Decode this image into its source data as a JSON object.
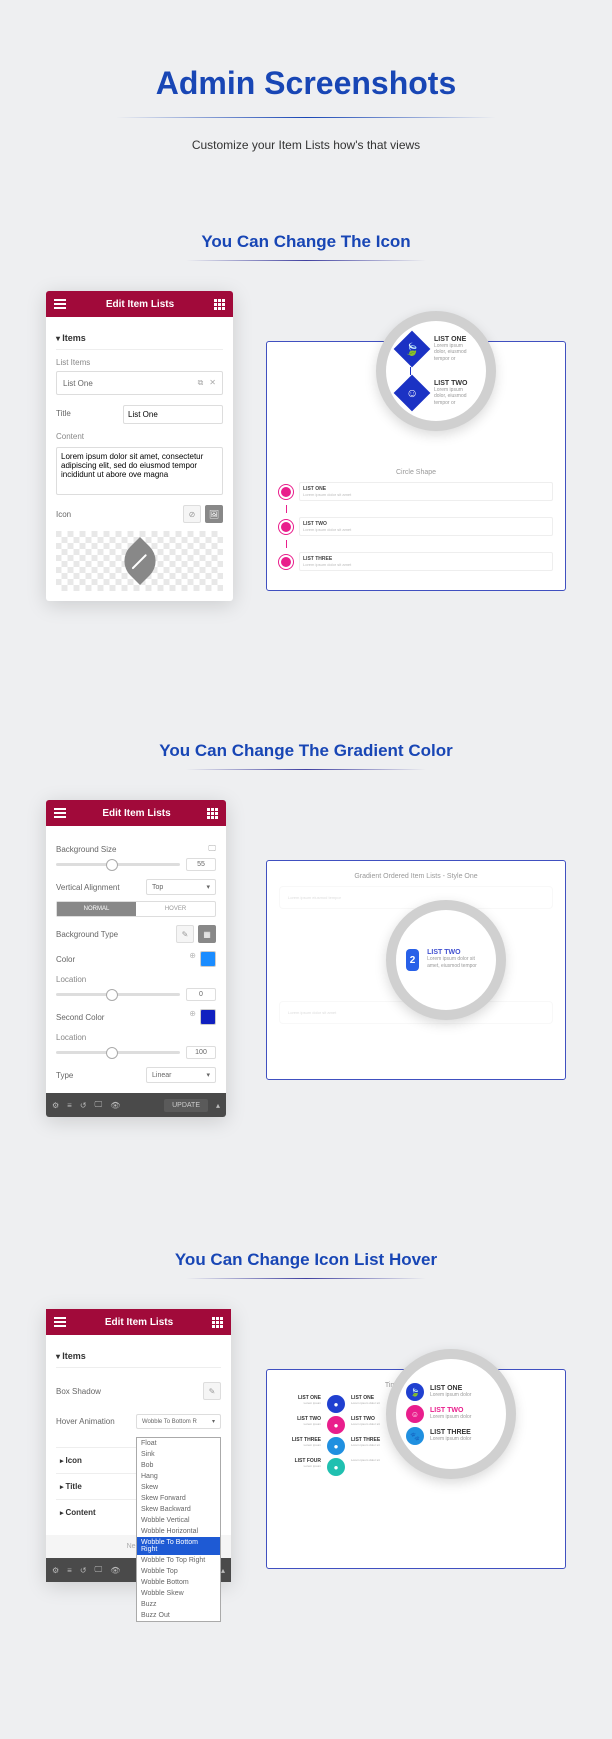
{
  "main": {
    "title": "Admin Screenshots",
    "subtitle": "Customize your Item Lists how's that views"
  },
  "sections": [
    {
      "title": "You Can Change The Icon"
    },
    {
      "title": "You Can Change The Gradient Color"
    },
    {
      "title": "You Can Change Icon List Hover"
    }
  ],
  "panel_header": "Edit Item Lists",
  "s1": {
    "accordion": "Items",
    "list_label": "List Items",
    "list_item": "List One",
    "title_label": "Title",
    "title_value": "List One",
    "content_label": "Content",
    "content_value": "Lorem ipsum dolor sit amet, consectetur adipiscing elit, sed do eiusmod tempor incididunt ut abore ove magna",
    "icon_label": "Icon",
    "lens": {
      "item1": {
        "title": "LIST ONE",
        "sub": "Lorem ipsum dolor, eiusmod tempor or"
      },
      "item2": {
        "title": "LIST TWO",
        "sub": "Lorem ipsum dolor, eiusmod tempor or"
      }
    },
    "preview_shape": "Circle Shape",
    "circles": [
      {
        "title": "LIST ONE",
        "sub": "Lorem ipsum dolor sit amet"
      },
      {
        "title": "LIST TWO",
        "sub": "Lorem ipsum dolor sit amet"
      },
      {
        "title": "LIST THREE",
        "sub": "Lorem ipsum dolor sit amet"
      }
    ]
  },
  "s2": {
    "bg_size": "Background Size",
    "bg_size_val": "55",
    "valign": "Vertical Alignment",
    "valign_val": "Top",
    "tabs": {
      "normal": "NORMAL",
      "hover": "HOVER"
    },
    "bg_type": "Background Type",
    "color": "Color",
    "color_val": "#1a8cff",
    "location": "Location",
    "location_val": "0",
    "second_color": "Second Color",
    "second_val": "#1020c0",
    "location2_val": "100",
    "type": "Type",
    "type_val": "Linear",
    "update": "UPDATE",
    "preview_title": "Gradient Ordered Item Lists - Style One",
    "lens": {
      "num": "2",
      "title": "LIST TWO",
      "sub": "Lorem ipsum dolor sit amet, eiusmod tempor"
    }
  },
  "s3": {
    "accordion": "Items",
    "box_shadow": "Box Shadow",
    "hover_anim": "Hover Animation",
    "hover_val": "Wobble To Bottom R",
    "options": [
      "Float",
      "Sink",
      "Bob",
      "Hang",
      "Skew",
      "Skew Forward",
      "Skew Backward",
      "Wobble Vertical",
      "Wobble Horizontal",
      "Wobble To Bottom Right",
      "Wobble To Top Right",
      "Wobble Top",
      "Wobble Bottom",
      "Wobble Skew",
      "Buzz",
      "Buzz Out"
    ],
    "selected_idx": 9,
    "acc_items": [
      "Icon",
      "Title",
      "Content"
    ],
    "need_help": "Need H",
    "preview_title": "Timeline Item Lists -",
    "timeline": [
      {
        "left": "LIST ONE",
        "right": "LIST ONE",
        "color": "#2040d0"
      },
      {
        "left": "LIST TWO",
        "right": "LIST TWO",
        "color": "#e91e8c"
      },
      {
        "left": "LIST THREE",
        "right": "LIST THREE",
        "color": "#2090e0"
      },
      {
        "left": "LIST FOUR",
        "right": "",
        "color": "#20c0b0"
      }
    ]
  }
}
